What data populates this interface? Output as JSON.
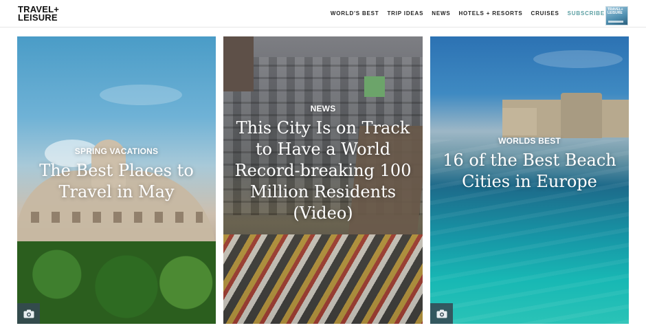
{
  "header": {
    "logo_line1": "TRAVEL+",
    "logo_line2": "LEISURE",
    "nav": [
      "WORLD'S BEST",
      "TRIP IDEAS",
      "NEWS",
      "HOTELS + RESORTS",
      "CRUISES",
      "SUBSCRIBE"
    ],
    "magazine_cover_title": "TRAVEL+ LEISURE"
  },
  "cards": [
    {
      "category": "SPRING VACATIONS",
      "headline": "The Best Places to Travel in May",
      "icon": "camera-icon"
    },
    {
      "category": "NEWS",
      "headline": "This City Is on Track to Have a World Record-breaking 100 Million Residents (Video)",
      "icon": ""
    },
    {
      "category": "WORLDS BEST",
      "headline": "16 of the Best Beach Cities in Europe",
      "icon": "camera-icon"
    }
  ],
  "colors": {
    "subscribe": "#5a9ea2",
    "camera_badge": "#344953"
  }
}
